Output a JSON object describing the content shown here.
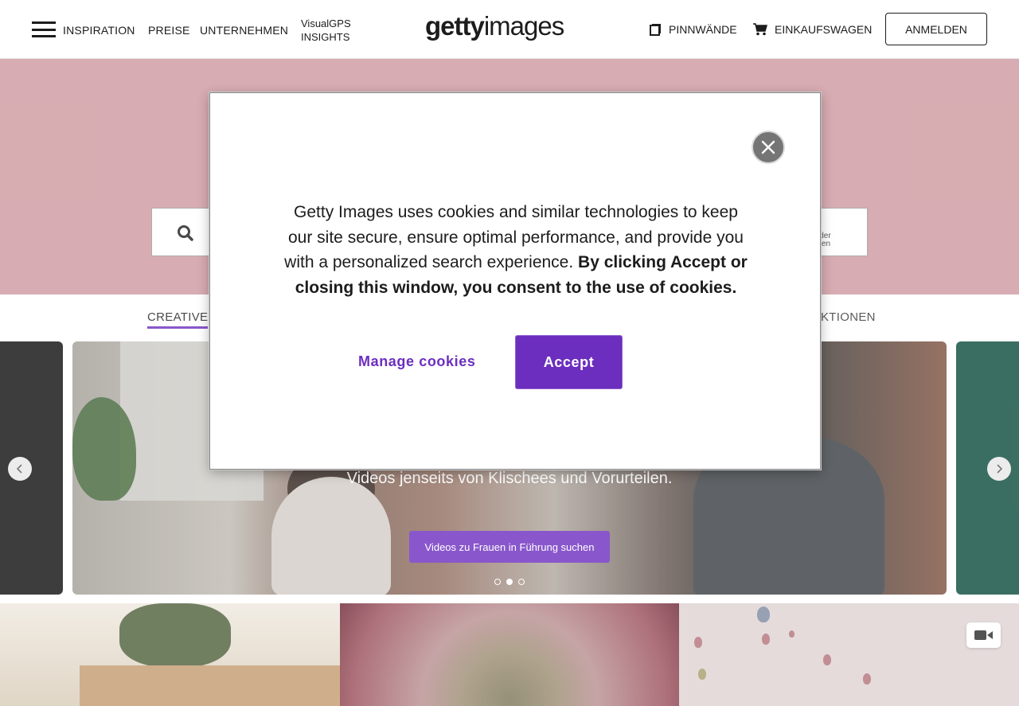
{
  "header": {
    "nav": {
      "inspiration": "INSPIRATION",
      "preise": "PREISE",
      "unternehmen": "UNTERNEHMEN",
      "visualgps_line1": "VisualGPS",
      "visualgps_line2": "INSIGHTS"
    },
    "logo": {
      "bold": "getty",
      "regular": "images"
    },
    "boards_label": "PINNWÄNDE",
    "cart_label": "EINKAUFSWAGEN",
    "login_label": "ANMELDEN"
  },
  "hero": {
    "bg_color": "#ce989f",
    "image_search_line1": "d oder",
    "image_search_line2": "uchen"
  },
  "tabs": {
    "creative": "CREATIVE",
    "collections_fragment": "KTIONEN"
  },
  "carousel": {
    "caption": "Videos jenseits von Klischees und Vorurteilen.",
    "cta_label": "Videos zu Frauen in Führung suchen",
    "dot_count": 3,
    "active_dot": 1
  },
  "cookie_modal": {
    "text_regular": "Getty Images uses cookies and similar technologies to keep our site secure, ensure optimal performance, and provide you with a personalized search experience. ",
    "text_bold": "By clicking Accept or closing this window, you consent to the use of cookies.",
    "manage_label": "Manage cookies",
    "accept_label": "Accept",
    "accent_color": "#6c2ebf"
  },
  "icons": {
    "menu": "hamburger-icon",
    "boards": "boards-icon",
    "cart": "cart-icon",
    "search": "search-icon",
    "image_search": "image-upload-icon",
    "close": "close-icon",
    "prev": "chevron-left-icon",
    "next": "chevron-right-icon",
    "video": "video-camera-icon"
  }
}
